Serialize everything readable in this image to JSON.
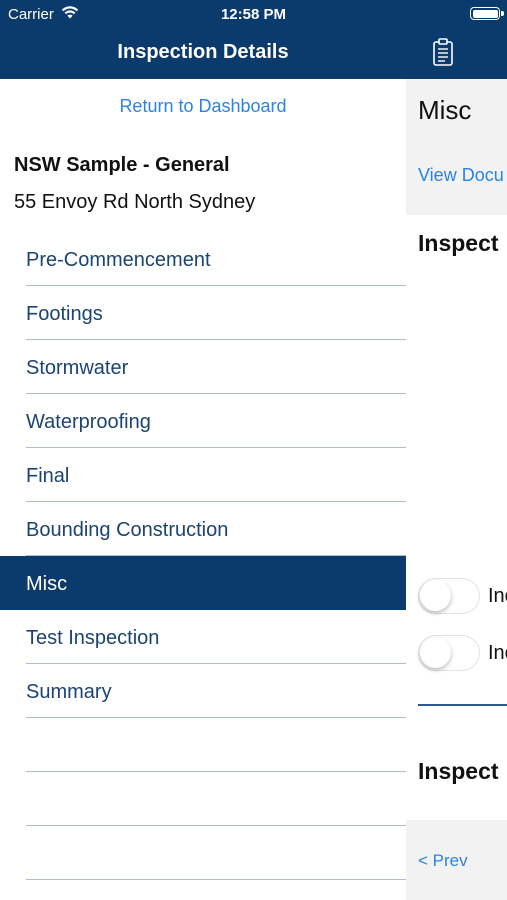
{
  "status_bar": {
    "carrier": "Carrier",
    "time": "12:58 PM"
  },
  "header": {
    "title": "Inspection Details",
    "right_icon": "clipboard-icon",
    "background_color": "#0b3a6c"
  },
  "sidebar": {
    "return_link": "Return to Dashboard",
    "site_name": "NSW Sample - General",
    "site_address": "55 Envoy Rd North Sydney",
    "items": [
      {
        "label": "Pre-Commencement",
        "selected": false
      },
      {
        "label": "Footings",
        "selected": false
      },
      {
        "label": "Stormwater",
        "selected": false
      },
      {
        "label": "Waterproofing",
        "selected": false
      },
      {
        "label": "Final",
        "selected": false
      },
      {
        "label": "Bounding Construction",
        "selected": false
      },
      {
        "label": "Misc",
        "selected": true
      },
      {
        "label": "Test Inspection",
        "selected": false
      },
      {
        "label": "Summary",
        "selected": false
      },
      {
        "label": "",
        "selected": false
      },
      {
        "label": "",
        "selected": false
      },
      {
        "label": "",
        "selected": false
      }
    ]
  },
  "detail": {
    "title": "Misc",
    "view_documents_link": "View Docu",
    "section_heading_1": "Inspect",
    "toggles": [
      {
        "label": "Inc",
        "on": false
      },
      {
        "label": "Inc",
        "on": false
      }
    ],
    "section_heading_2": "Inspect",
    "prev_link": "< Prev"
  },
  "colors": {
    "accent_blue": "#0b3a6c",
    "link_blue": "#2a83e6",
    "menu_text": "#1b4470"
  }
}
